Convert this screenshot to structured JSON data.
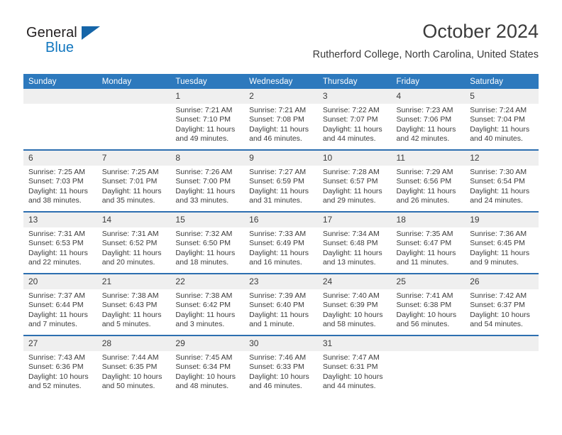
{
  "branding": {
    "logo_word_1": "General",
    "logo_word_2": "Blue",
    "flag_icon": "blue-triangle-flag-icon"
  },
  "header": {
    "month_title": "October 2024",
    "location": "Rutherford College, North Carolina, United States"
  },
  "calendar": {
    "weekday_headers": [
      "Sunday",
      "Monday",
      "Tuesday",
      "Wednesday",
      "Thursday",
      "Friday",
      "Saturday"
    ],
    "colors": {
      "header_blue": "#2d79bd",
      "row_rule_blue": "#2d6fb0",
      "daynum_band": "#efefef",
      "text": "#3b3b3b",
      "logo_blue": "#1277bf"
    },
    "weeks": [
      [
        {
          "day": "",
          "blank": true
        },
        {
          "day": "",
          "blank": true
        },
        {
          "day": "1",
          "sunrise": "Sunrise: 7:21 AM",
          "sunset": "Sunset: 7:10 PM",
          "daylight": "Daylight: 11 hours and 49 minutes."
        },
        {
          "day": "2",
          "sunrise": "Sunrise: 7:21 AM",
          "sunset": "Sunset: 7:08 PM",
          "daylight": "Daylight: 11 hours and 46 minutes."
        },
        {
          "day": "3",
          "sunrise": "Sunrise: 7:22 AM",
          "sunset": "Sunset: 7:07 PM",
          "daylight": "Daylight: 11 hours and 44 minutes."
        },
        {
          "day": "4",
          "sunrise": "Sunrise: 7:23 AM",
          "sunset": "Sunset: 7:06 PM",
          "daylight": "Daylight: 11 hours and 42 minutes."
        },
        {
          "day": "5",
          "sunrise": "Sunrise: 7:24 AM",
          "sunset": "Sunset: 7:04 PM",
          "daylight": "Daylight: 11 hours and 40 minutes."
        }
      ],
      [
        {
          "day": "6",
          "sunrise": "Sunrise: 7:25 AM",
          "sunset": "Sunset: 7:03 PM",
          "daylight": "Daylight: 11 hours and 38 minutes."
        },
        {
          "day": "7",
          "sunrise": "Sunrise: 7:25 AM",
          "sunset": "Sunset: 7:01 PM",
          "daylight": "Daylight: 11 hours and 35 minutes."
        },
        {
          "day": "8",
          "sunrise": "Sunrise: 7:26 AM",
          "sunset": "Sunset: 7:00 PM",
          "daylight": "Daylight: 11 hours and 33 minutes."
        },
        {
          "day": "9",
          "sunrise": "Sunrise: 7:27 AM",
          "sunset": "Sunset: 6:59 PM",
          "daylight": "Daylight: 11 hours and 31 minutes."
        },
        {
          "day": "10",
          "sunrise": "Sunrise: 7:28 AM",
          "sunset": "Sunset: 6:57 PM",
          "daylight": "Daylight: 11 hours and 29 minutes."
        },
        {
          "day": "11",
          "sunrise": "Sunrise: 7:29 AM",
          "sunset": "Sunset: 6:56 PM",
          "daylight": "Daylight: 11 hours and 26 minutes."
        },
        {
          "day": "12",
          "sunrise": "Sunrise: 7:30 AM",
          "sunset": "Sunset: 6:54 PM",
          "daylight": "Daylight: 11 hours and 24 minutes."
        }
      ],
      [
        {
          "day": "13",
          "sunrise": "Sunrise: 7:31 AM",
          "sunset": "Sunset: 6:53 PM",
          "daylight": "Daylight: 11 hours and 22 minutes."
        },
        {
          "day": "14",
          "sunrise": "Sunrise: 7:31 AM",
          "sunset": "Sunset: 6:52 PM",
          "daylight": "Daylight: 11 hours and 20 minutes."
        },
        {
          "day": "15",
          "sunrise": "Sunrise: 7:32 AM",
          "sunset": "Sunset: 6:50 PM",
          "daylight": "Daylight: 11 hours and 18 minutes."
        },
        {
          "day": "16",
          "sunrise": "Sunrise: 7:33 AM",
          "sunset": "Sunset: 6:49 PM",
          "daylight": "Daylight: 11 hours and 16 minutes."
        },
        {
          "day": "17",
          "sunrise": "Sunrise: 7:34 AM",
          "sunset": "Sunset: 6:48 PM",
          "daylight": "Daylight: 11 hours and 13 minutes."
        },
        {
          "day": "18",
          "sunrise": "Sunrise: 7:35 AM",
          "sunset": "Sunset: 6:47 PM",
          "daylight": "Daylight: 11 hours and 11 minutes."
        },
        {
          "day": "19",
          "sunrise": "Sunrise: 7:36 AM",
          "sunset": "Sunset: 6:45 PM",
          "daylight": "Daylight: 11 hours and 9 minutes."
        }
      ],
      [
        {
          "day": "20",
          "sunrise": "Sunrise: 7:37 AM",
          "sunset": "Sunset: 6:44 PM",
          "daylight": "Daylight: 11 hours and 7 minutes."
        },
        {
          "day": "21",
          "sunrise": "Sunrise: 7:38 AM",
          "sunset": "Sunset: 6:43 PM",
          "daylight": "Daylight: 11 hours and 5 minutes."
        },
        {
          "day": "22",
          "sunrise": "Sunrise: 7:38 AM",
          "sunset": "Sunset: 6:42 PM",
          "daylight": "Daylight: 11 hours and 3 minutes."
        },
        {
          "day": "23",
          "sunrise": "Sunrise: 7:39 AM",
          "sunset": "Sunset: 6:40 PM",
          "daylight": "Daylight: 11 hours and 1 minute."
        },
        {
          "day": "24",
          "sunrise": "Sunrise: 7:40 AM",
          "sunset": "Sunset: 6:39 PM",
          "daylight": "Daylight: 10 hours and 58 minutes."
        },
        {
          "day": "25",
          "sunrise": "Sunrise: 7:41 AM",
          "sunset": "Sunset: 6:38 PM",
          "daylight": "Daylight: 10 hours and 56 minutes."
        },
        {
          "day": "26",
          "sunrise": "Sunrise: 7:42 AM",
          "sunset": "Sunset: 6:37 PM",
          "daylight": "Daylight: 10 hours and 54 minutes."
        }
      ],
      [
        {
          "day": "27",
          "sunrise": "Sunrise: 7:43 AM",
          "sunset": "Sunset: 6:36 PM",
          "daylight": "Daylight: 10 hours and 52 minutes."
        },
        {
          "day": "28",
          "sunrise": "Sunrise: 7:44 AM",
          "sunset": "Sunset: 6:35 PM",
          "daylight": "Daylight: 10 hours and 50 minutes."
        },
        {
          "day": "29",
          "sunrise": "Sunrise: 7:45 AM",
          "sunset": "Sunset: 6:34 PM",
          "daylight": "Daylight: 10 hours and 48 minutes."
        },
        {
          "day": "30",
          "sunrise": "Sunrise: 7:46 AM",
          "sunset": "Sunset: 6:33 PM",
          "daylight": "Daylight: 10 hours and 46 minutes."
        },
        {
          "day": "31",
          "sunrise": "Sunrise: 7:47 AM",
          "sunset": "Sunset: 6:31 PM",
          "daylight": "Daylight: 10 hours and 44 minutes."
        },
        {
          "day": "",
          "blank": true
        },
        {
          "day": "",
          "blank": true
        }
      ]
    ]
  }
}
